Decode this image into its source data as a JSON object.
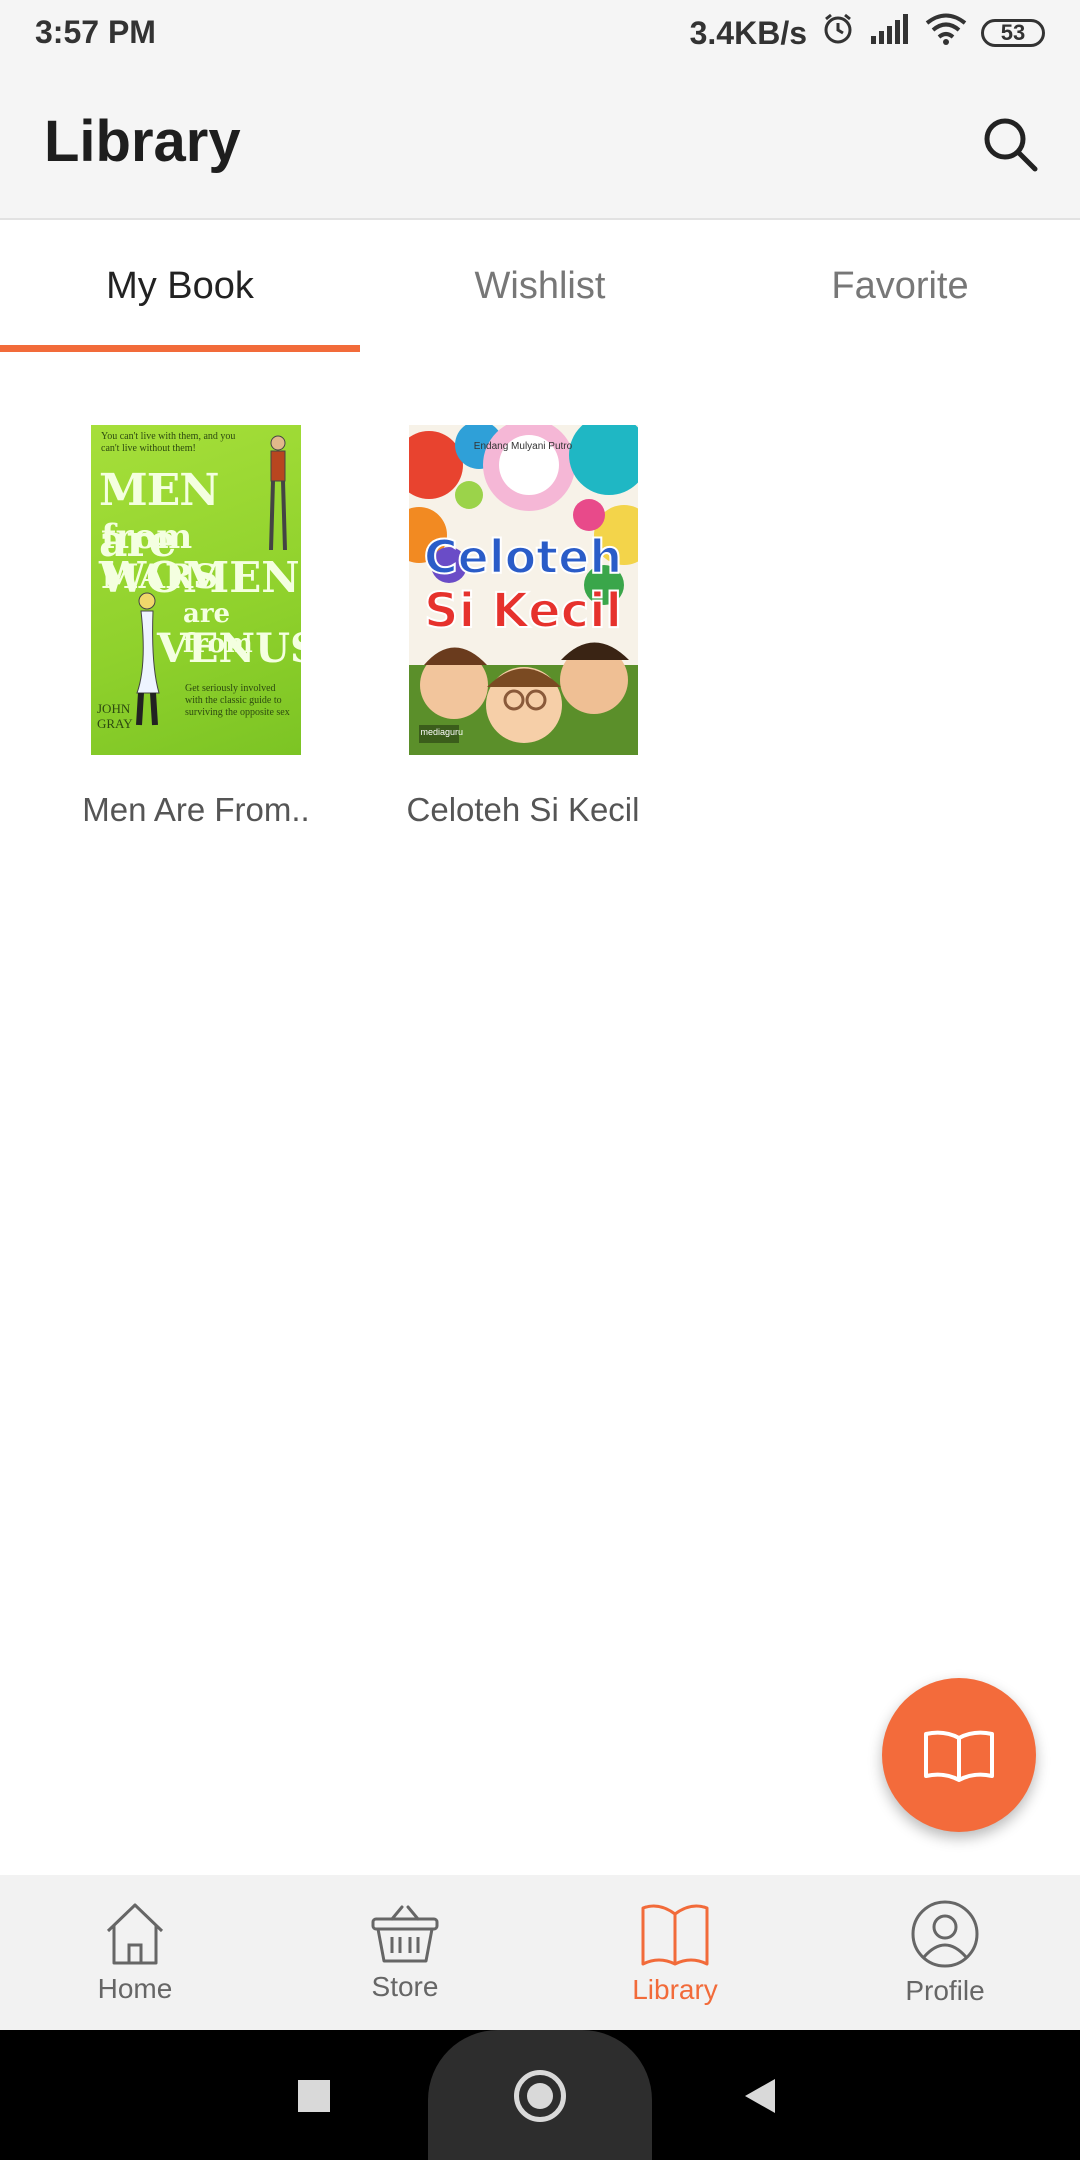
{
  "status_bar": {
    "time": "3:57 PM",
    "net_speed": "3.4KB/s",
    "battery": "53",
    "icons": [
      "alarm-icon",
      "signal-icon",
      "wifi-icon",
      "battery-icon"
    ]
  },
  "app_bar": {
    "title": "Library",
    "search_icon": "search-icon"
  },
  "tabs": [
    {
      "label": "My Book",
      "active": true
    },
    {
      "label": "Wishlist",
      "active": false
    },
    {
      "label": "Favorite",
      "active": false
    }
  ],
  "books": [
    {
      "title": "Men Are From..",
      "cover": {
        "tagline": "You can't live with them, and you can't live without them!",
        "line1": "MEN are",
        "line2": "from MARS",
        "line3": "WOMEN",
        "line4": "are from",
        "line5": "VENUS",
        "author": "JOHN GRAY",
        "blurb": "Get seriously involved with the classic guide to surviving the opposite sex"
      }
    },
    {
      "title": "Celoteh Si Kecil",
      "cover": {
        "author": "Endang Mulyani Putro",
        "line1": "Celoteh",
        "line2": "Si Kecil",
        "publisher": "mediaguru"
      }
    }
  ],
  "fab": {
    "icon": "open-book-icon"
  },
  "bottom_nav": [
    {
      "label": "Home",
      "icon": "home-icon",
      "active": false
    },
    {
      "label": "Store",
      "icon": "basket-icon",
      "active": false
    },
    {
      "label": "Library",
      "icon": "library-book-icon",
      "active": true
    },
    {
      "label": "Profile",
      "icon": "profile-icon",
      "active": false
    }
  ],
  "colors": {
    "accent": "#f26b3a",
    "appbar_bg": "#f5f5f5",
    "nav_bg": "#f2f2f2"
  }
}
